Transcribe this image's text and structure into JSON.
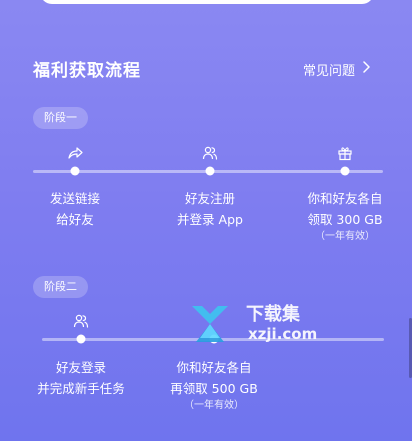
{
  "header": {
    "title": "福利获取流程",
    "faq_label": "常见问题"
  },
  "stages": [
    {
      "label": "阶段一",
      "steps": [
        {
          "icon": "share-icon",
          "line1": "发送链接",
          "line2": "给好友",
          "note": ""
        },
        {
          "icon": "friends-icon",
          "line1": "好友注册",
          "line2": "并登录 App",
          "note": ""
        },
        {
          "icon": "gift-icon",
          "line1": "你和好友各自",
          "line2": "领取 300 GB",
          "note": "（一年有效）"
        }
      ]
    },
    {
      "label": "阶段二",
      "steps": [
        {
          "icon": "friends-icon",
          "line1": "好友登录",
          "line2": "并完成新手任务",
          "note": ""
        },
        {
          "icon": "",
          "line1": "你和好友各自",
          "line2": "再领取 500 GB",
          "note": "（一年有效）"
        }
      ]
    }
  ],
  "watermark": {
    "brand": "下载集",
    "domain": "xzji.com"
  },
  "colors": {
    "background_top": "#8a88f2",
    "background_bottom": "#6f74ee",
    "text": "#ffffff"
  }
}
